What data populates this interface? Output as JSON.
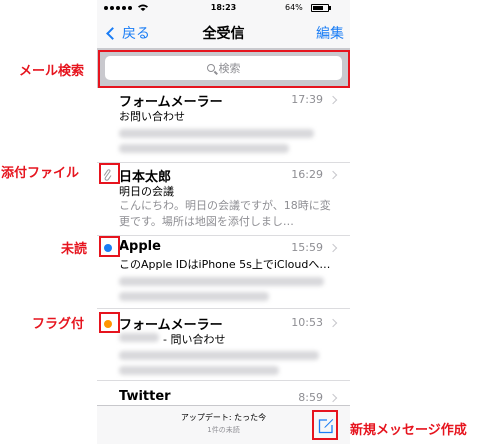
{
  "status_bar": {
    "time": "18:23",
    "battery": "64%"
  },
  "nav": {
    "back_label": "戻る",
    "title": "全受信",
    "edit_label": "編集"
  },
  "search": {
    "placeholder": "検索"
  },
  "mails": [
    {
      "sender": "フォームメーラー",
      "time": "17:39",
      "subject": "お問い合わせ",
      "preview": "",
      "marker": "none"
    },
    {
      "sender": "日本太郎",
      "time": "16:29",
      "subject": "明日の会議",
      "preview": "こんにちわ。明日の会議ですが、18時に変更です。場所は地図を添付しまし…",
      "marker": "attachment"
    },
    {
      "sender": "Apple",
      "time": "15:59",
      "subject": "このApple IDはiPhone 5s上でiCloudへ…",
      "preview": "",
      "marker": "unread"
    },
    {
      "sender": "フォームメーラー",
      "time": "10:53",
      "subject": "- 問い合わせ",
      "preview": "",
      "marker": "flag"
    },
    {
      "sender": "Twitter",
      "time": "8:59",
      "subject": "",
      "preview": "",
      "marker": "none"
    }
  ],
  "toolbar": {
    "status": "アップデート: たった今",
    "unread_count": "1件の未読"
  },
  "annotations": {
    "search": "メール検索",
    "attachment": "添付ファイル",
    "unread": "未読",
    "flag": "フラグ付",
    "compose": "新規メッセージ作成"
  },
  "colors": {
    "accent": "#1a7df5",
    "unread": "#1a7df5",
    "flag": "#ff9500",
    "callout": "#e6141e"
  },
  "icons": [
    "back-chevron-icon",
    "search-icon",
    "paperclip-icon",
    "unread-dot-icon",
    "flag-dot-icon",
    "compose-icon",
    "wifi-icon",
    "battery-icon"
  ]
}
